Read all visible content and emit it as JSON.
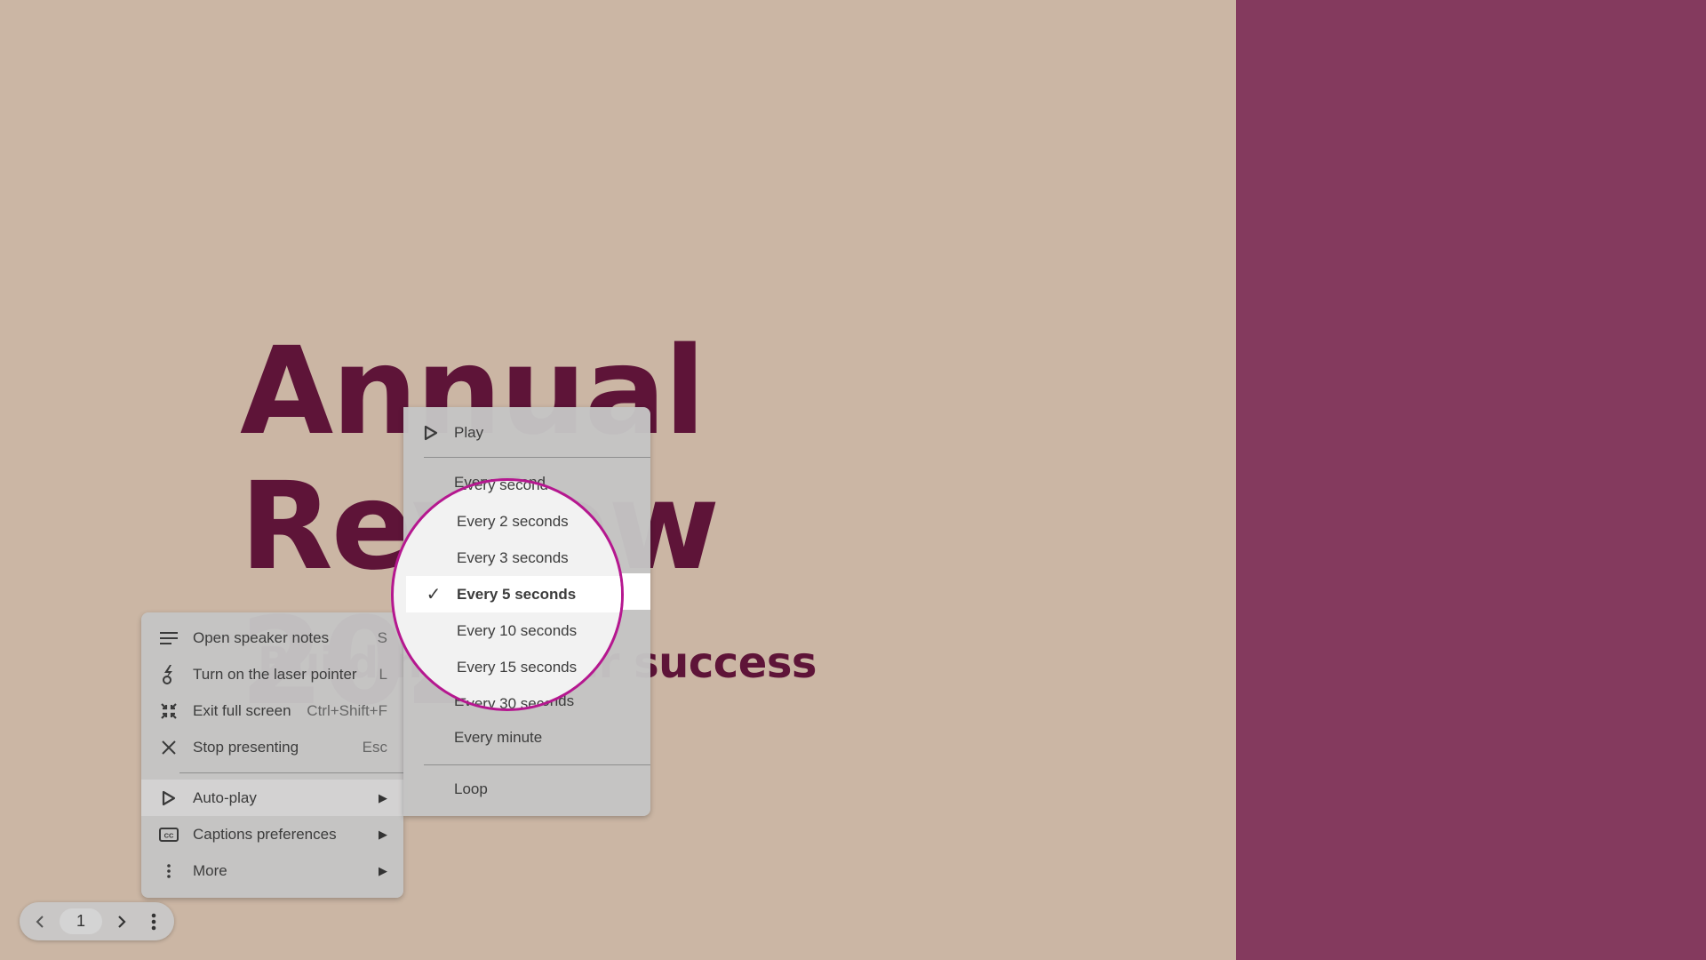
{
  "slide": {
    "title_line1": "Annual Review",
    "title_line2": "2021",
    "subtitle": "Building on our success",
    "colors": {
      "background": "#cbb6a4",
      "accent_panel": "#843a5e",
      "title": "#5e1438"
    }
  },
  "main_menu": {
    "items": [
      {
        "label": "Open speaker notes",
        "shortcut": "S",
        "icon": "speaker-notes-icon"
      },
      {
        "label": "Turn on the laser pointer",
        "shortcut": "L",
        "icon": "laser-pointer-icon"
      },
      {
        "label": "Exit full screen",
        "shortcut": "Ctrl+Shift+F",
        "icon": "exit-fullscreen-icon"
      },
      {
        "label": "Stop presenting",
        "shortcut": "Esc",
        "icon": "close-icon"
      },
      {
        "label": "Auto-play",
        "submenu": true,
        "icon": "play-icon"
      },
      {
        "label": "Captions preferences",
        "submenu": true,
        "icon": "captions-icon"
      },
      {
        "label": "More",
        "submenu": true,
        "icon": "more-vert-icon"
      }
    ],
    "submenu_arrow": "▶"
  },
  "autoplay_menu": {
    "play_label": "Play",
    "intervals": [
      "Every second",
      "Every 2 seconds",
      "Every 3 seconds",
      "Every 5 seconds",
      "Every 10 seconds",
      "Every 15 seconds",
      "Every 30 seconds",
      "Every minute"
    ],
    "selected_interval": "Every 5 seconds",
    "loop_label": "Loop",
    "check_glyph": "✓"
  },
  "control_bar": {
    "current_page": "1",
    "prev_glyph": "‹",
    "next_glyph": "›"
  },
  "highlight_color": "#b5178f"
}
